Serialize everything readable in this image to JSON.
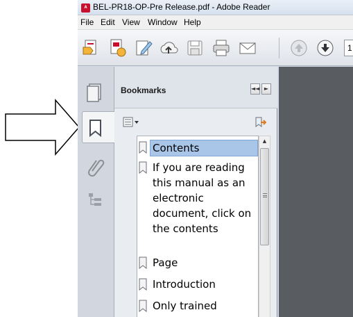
{
  "window": {
    "title": "BEL-PR18-OP-Pre Release.pdf - Adobe Reader",
    "app_icon": "adobe-reader-icon"
  },
  "menu": {
    "items": [
      "File",
      "Edit",
      "View",
      "Window",
      "Help"
    ]
  },
  "toolbar": {
    "buttons": [
      "create-pdf-icon",
      "combine-files-icon",
      "edit-sign-icon",
      "upload-cloud-icon",
      "save-icon",
      "print-icon",
      "email-icon",
      "previous-page-icon",
      "next-page-icon"
    ],
    "page_number": "1"
  },
  "nav_panel": {
    "buttons": [
      "page-thumbnails-icon",
      "bookmarks-icon",
      "attachments-icon",
      "layers-icon"
    ],
    "active": "bookmarks-icon"
  },
  "bookmarks": {
    "title": "Bookmarks",
    "collapse_label": "◄◄",
    "close_label": "►",
    "options_icon": "options-menu-icon",
    "expand_icon": "expand-bookmark-icon",
    "items": [
      {
        "label": "Contents",
        "selected": true
      },
      {
        "label": "If you are reading\nthis manual as an\nelectronic\ndocument, click on\nthe contents",
        "selected": false
      },
      {
        "label": "Page",
        "selected": false
      },
      {
        "label": "Introduction",
        "selected": false
      },
      {
        "label": "Only trained",
        "selected": false
      }
    ]
  },
  "colors": {
    "selected_bookmark": "#a9c6e8",
    "document_area": "#595c61",
    "panel_bg": "#e9ecf1"
  },
  "callout": {
    "icon": "pointing-arrow-icon"
  }
}
